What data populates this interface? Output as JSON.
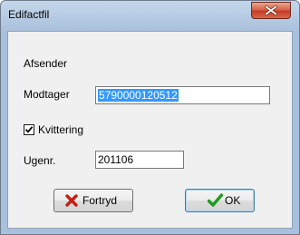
{
  "window": {
    "title": "Edifactfil"
  },
  "form": {
    "sender_label": "Afsender",
    "receiver_label": "Modtager",
    "receiver_value": "5790000120512",
    "receipt_label": "Kvittering",
    "receipt_checked": true,
    "week_label": "Ugenr.",
    "week_value": "201106"
  },
  "buttons": {
    "cancel_label": "Fortryd",
    "cancel_icon": "red-x-icon",
    "ok_label": "OK",
    "ok_icon": "green-checkmark-icon"
  },
  "colors": {
    "selection": "#3399ff",
    "cancel_icon": "#c81d11",
    "ok_icon": "#1f9a1f"
  }
}
